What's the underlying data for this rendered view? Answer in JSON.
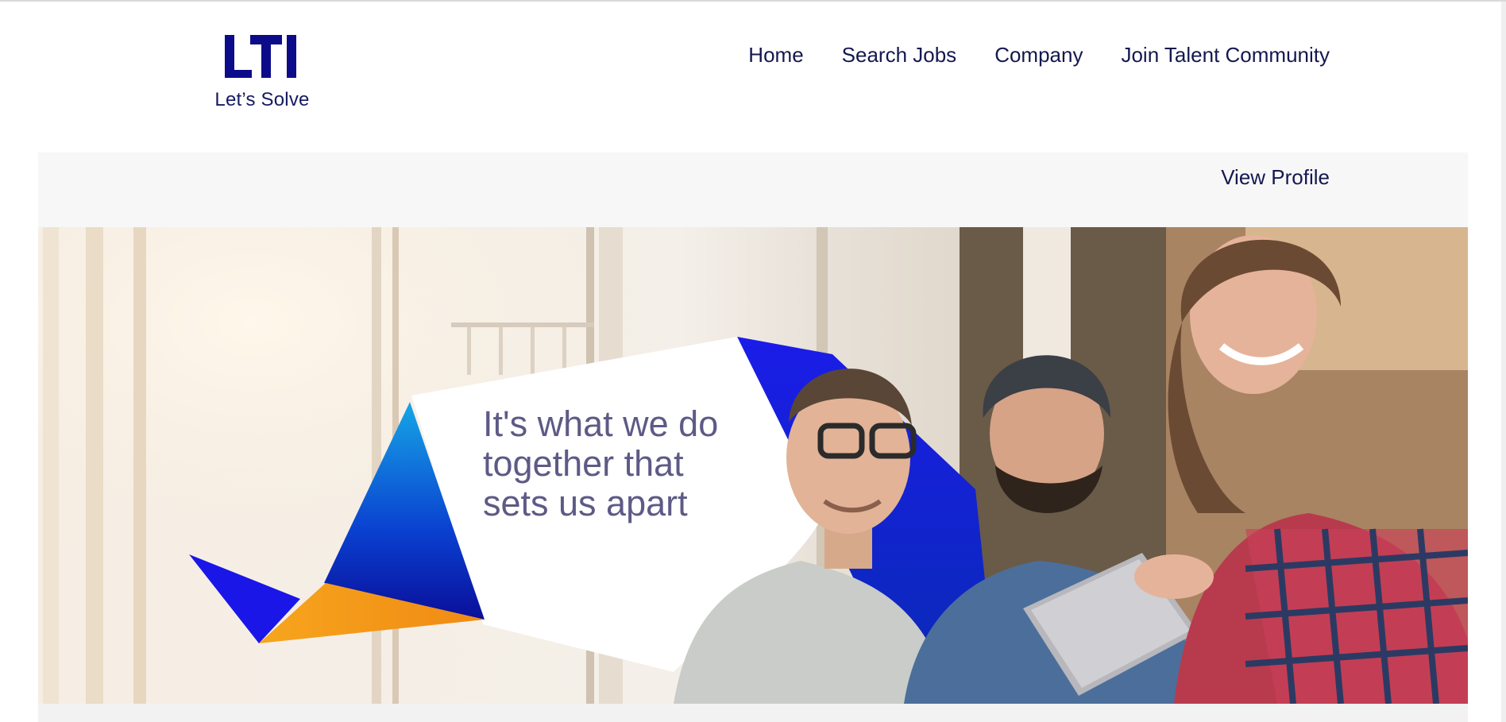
{
  "brand": {
    "logo_text": "LTI",
    "tagline": "Let’s Solve",
    "color": "#0c0c8a"
  },
  "nav": {
    "items": [
      {
        "label": "Home"
      },
      {
        "label": "Search Jobs"
      },
      {
        "label": "Company"
      },
      {
        "label": "Join Talent Community"
      }
    ]
  },
  "profile_bar": {
    "view_profile_label": "View Profile"
  },
  "hero": {
    "headline_lines": [
      "It's what we do",
      "together that",
      "sets us apart"
    ],
    "image": "team-photo-with-lti-shapes"
  },
  "colors": {
    "nav_text": "#14184f",
    "accent_blue": "#1a16e8",
    "accent_orange": "#f59a1c",
    "hero_text": "#5d5a86"
  }
}
